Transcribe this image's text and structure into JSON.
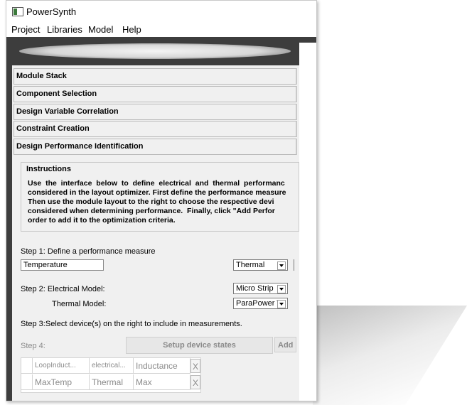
{
  "window": {
    "title": "PowerSynth"
  },
  "menu": {
    "items": [
      "Project",
      "Libraries",
      "Model",
      "Help"
    ]
  },
  "accordion": [
    "Module Stack",
    "Component Selection",
    "Design Variable Correlation",
    "Constraint Creation",
    "Design Performance Identification"
  ],
  "instructions": {
    "title": "Instructions",
    "lines": [
      "Use  the  interface  below  to  define  electrical  and  thermal  performanc",
      "considered in the layout optimizer. First define the performance measure",
      "Then use the module layout to the right to choose the respective devi",
      "considered when determining performance.  Finally, click \"Add Perfor",
      "order to add it to the optimization criteria."
    ]
  },
  "step1": {
    "label": "Step 1:  Define a performance measure",
    "name_value": "Temperature",
    "type_value": "Thermal"
  },
  "step2": {
    "label": "Step 2:  Electrical Model:",
    "electrical_value": "Micro Strip",
    "thermal_label": "Thermal Model:",
    "thermal_value": "ParaPower Th"
  },
  "step3": {
    "label": "Step 3:Select device(s) on the right to include in measurements."
  },
  "step4": {
    "label": "Step 4:",
    "setup_button": "Setup device states",
    "add_button": "Add"
  },
  "table": {
    "rows": [
      {
        "name": "LoopInduct...",
        "model": "electrical...",
        "measure": "Inductance",
        "remove": "X"
      },
      {
        "name": "MaxTemp",
        "model": "Thermal",
        "measure": "Max",
        "remove": "X"
      }
    ]
  }
}
